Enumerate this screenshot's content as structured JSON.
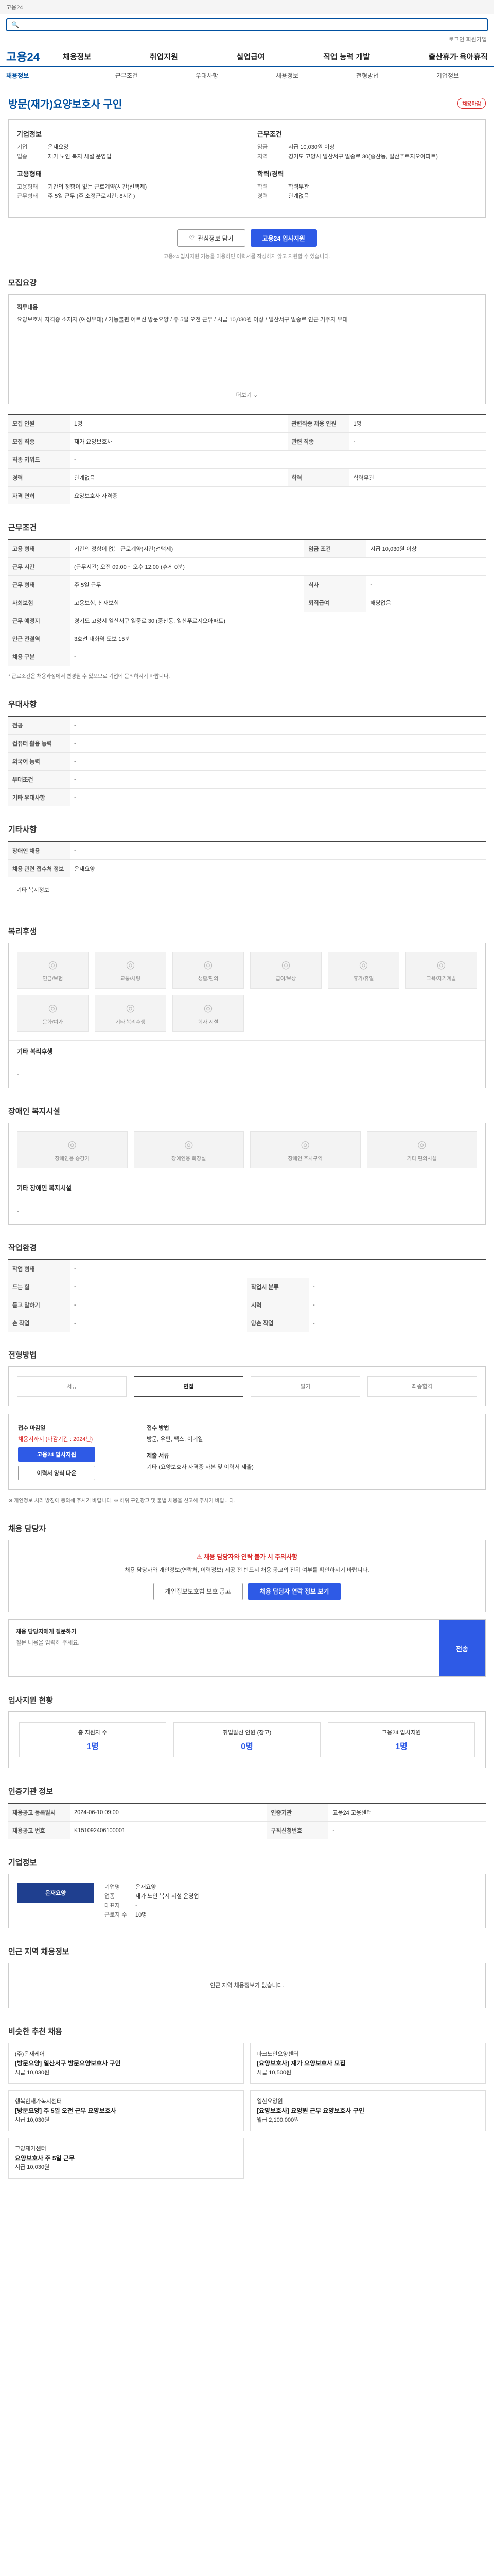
{
  "topbar": {
    "text": "고용24"
  },
  "user_links": "로그인 회원가입",
  "gnb": {
    "logo": "고용24",
    "menu": [
      "채용정보",
      "취업지원",
      "실업급여",
      "직업 능력 개발",
      "출산휴가·육아휴직"
    ]
  },
  "subnav": [
    "채용정보",
    "근무조건",
    "우대사항",
    "채용정보",
    "전형방법",
    "기업정보"
  ],
  "job": {
    "title": "방문(재가)요양보호사 구인",
    "badge": "채용마감",
    "company_label": "기업정보",
    "company": [
      {
        "k": "기업",
        "v": "은재요양"
      },
      {
        "k": "업종",
        "v": "재가 노인 복지 시설 운영업"
      }
    ],
    "cond_label": "근무조건",
    "cond": [
      {
        "k": "임금",
        "v": "시급 10,030원 이상"
      },
      {
        "k": "지역",
        "v": "경기도 고양시 일산서구 일중로 30(중산동, 일산푸르지오아파트)"
      }
    ],
    "type_label": "고용형태",
    "types": [
      {
        "k": "고용형태",
        "v": "기간의 정함이 없는 근로계약(시간(선택제)"
      },
      {
        "k": "근무형태",
        "v": "주 5일 근무 (주 소정근로시간: 8시간)"
      }
    ],
    "exp_label": "학력/경력",
    "exp": [
      {
        "k": "학력",
        "v": "학력무관"
      },
      {
        "k": "경력",
        "v": "관계없음"
      }
    ],
    "btn_scrap": "관심정보 담기",
    "btn_apply": "고용24 입사지원",
    "note": "고용24 입사지원 기능을 이용하면 이력서를 작성하지 않고 지원할 수 있습니다."
  },
  "recruit": {
    "title": "모집요강",
    "desc_head": "직무내용",
    "desc": "요양보호사 자격증 소지자 (여성우대) / 거동불편 어르신 방문요양 / 주 5일 오전 근무 / 시급 10,030원 이상 / 일산서구 일중로 인근 거주자 우대",
    "more": "더보기",
    "rows": [
      {
        "k": "모집 인원",
        "v": "1명",
        "k2": "관련직종 채용 인원",
        "v2": "1명"
      },
      {
        "k": "모집 직종",
        "v": "재가 요양보호사",
        "k2": "관련 직종",
        "v2": "-"
      },
      {
        "k": "직종 키워드",
        "v": "-",
        "k2": "",
        "v2": ""
      },
      {
        "k": "경력",
        "v": "관계없음",
        "k2": "학력",
        "v2": "학력무관"
      },
      {
        "k": "자격 면허",
        "v": "요양보호사 자격증",
        "k2": "",
        "v2": ""
      }
    ]
  },
  "conditions": {
    "title": "근무조건",
    "rows": [
      {
        "k": "고용 형태",
        "v": "기간의 정함이 없는 근로계약(시간(선택제)",
        "k2": "임금 조건",
        "v2": "시급 10,030원 이상"
      },
      {
        "k": "근무 시간",
        "v": "(근무시간) 오전 09:00 ~ 오후 12:00 (휴게 0분)",
        "k2": "",
        "v2": ""
      },
      {
        "k": "근무 형태",
        "v": "주 5일 근무",
        "k2": "식사",
        "v2": "-"
      },
      {
        "k": "사회보험",
        "v": "고용보험, 산재보험",
        "k2": "퇴직급여",
        "v2": "해당없음"
      },
      {
        "k": "근무 예정지",
        "v": "경기도 고양시 일산서구 일중로 30 (중산동, 일산푸르지오아파트)",
        "k2": "",
        "v2": ""
      },
      {
        "k": "인근 전철역",
        "v": "3호선 대화역 도보 15분",
        "k2": "",
        "v2": ""
      },
      {
        "k": "채용 구분",
        "v": "-",
        "k2": "",
        "v2": ""
      }
    ],
    "note": "* 근로조건은 채용과정에서 변경될 수 있으므로 기업에 문의하시기 바랍니다."
  },
  "prefer": {
    "title": "우대사항",
    "rows": [
      {
        "k": "전공",
        "v": "-"
      },
      {
        "k": "컴퓨터 활용 능력",
        "v": "-"
      },
      {
        "k": "외국어 능력",
        "v": "-"
      },
      {
        "k": "우대조건",
        "v": "-"
      },
      {
        "k": "기타 우대사항",
        "v": "-"
      }
    ]
  },
  "etc": {
    "title": "기타사항",
    "rows": [
      {
        "k": "장애인 채용",
        "v": "-"
      },
      {
        "k": "채용 관련 접수처 정보",
        "v": "은재요양"
      }
    ],
    "more": "기타 복지정보"
  },
  "welfare": {
    "title": "복리후생",
    "items": [
      "연금/보험",
      "교통/차량",
      "생활/편의",
      "급여/보상",
      "휴가/휴일",
      "교육/자기계발",
      "문화/여가",
      "기타 복리후생",
      "회사 시설"
    ],
    "subhead": "기타 복리후생",
    "sub_value": "-"
  },
  "disabled": {
    "title": "장애인 복지시설",
    "items": [
      "장애인용 승강기",
      "장애인용 화장실",
      "장애인 주차구역",
      "기타 편의시설"
    ],
    "subhead": "기타 장애인 복지시설",
    "sub_value": "-"
  },
  "workenv": {
    "title": "작업환경",
    "rows": [
      {
        "k": "작업 형태",
        "v": "-",
        "k2": "",
        "v2": ""
      },
      {
        "k": "드는 힘",
        "v": "-",
        "k2": "작업시 분류",
        "v2": "-"
      },
      {
        "k": "듣고 말하기",
        "v": "-",
        "k2": "시력",
        "v2": "-"
      },
      {
        "k": "손 작업",
        "v": "-",
        "k2": "양손 작업",
        "v2": "-"
      }
    ]
  },
  "process": {
    "title": "전형방법",
    "steps": [
      "서류",
      "면접",
      "필기",
      "최종합격"
    ],
    "active": 1
  },
  "apply": {
    "deadline_head": "접수 마감일",
    "deadline": "채용시까지 (마감기간 : 2024년)",
    "btn_apply": "고용24 입사지원",
    "btn_form": "이력서 양식 다운",
    "method_head": "접수 방법",
    "method": "방문, 우편, 팩스, 이메일",
    "docs_head": "제출 서류",
    "docs": "기타 (요양보호사 자격증 사본 및 이력서 제출)",
    "notes": "※ 개인정보 처리 방침에 동의해 주시기 바랍니다. ※ 허위 구인광고 및 불법 채용을 신고해 주시기 바랍니다."
  },
  "warning": {
    "title": "채용 담당자",
    "warn": "채용 담당자와 연락 불가 시 주의사항",
    "body": "채용 담당자와 개인정보(연락처, 이력정보) 제공 전 반드시 채용 공고의 진위 여부를 확인하시기 바랍니다.",
    "btn1": "개인정보보호법 보호 공고",
    "btn2": "채용 담당자 연락 정보 보기",
    "report_head": "채용 담당자에게 질문하기",
    "report_placeholder": "질문 내용을 입력해 주세요.",
    "send": "전송"
  },
  "stats": {
    "title": "입사지원 현황",
    "items": [
      {
        "label": "총 지원자 수",
        "num": "1명"
      },
      {
        "label": "취업알선 인원 (참고)",
        "num": "0명"
      },
      {
        "label": "고용24 입사지원",
        "num": "1명"
      }
    ]
  },
  "meta": {
    "title": "인증기관 정보",
    "rows": [
      {
        "k": "채용공고 등록일시",
        "v": "2024-06-10 09:00",
        "k2": "인증기관",
        "v2": "고용24 고용센터"
      },
      {
        "k": "채용공고 번호",
        "v": "K151092406100001",
        "k2": "구직신청번호",
        "v2": "-"
      }
    ]
  },
  "company_info": {
    "title": "기업정보",
    "logo": "은재요양",
    "rows": [
      {
        "k": "기업명",
        "v": "은재요양"
      },
      {
        "k": "업종",
        "v": "재가 노인 복지 시설 운영업"
      },
      {
        "k": "대표자",
        "v": "-"
      },
      {
        "k": "근로자 수",
        "v": "10명"
      }
    ]
  },
  "similar": {
    "title": "인근 지역 채용정보",
    "empty": "인근 지역 채용정보가 없습니다."
  },
  "recommend": {
    "title": "비슷한 추천 채용",
    "cards": [
      {
        "co": "(주)은재케어",
        "t": "[방문요양] 일산서구 방문요양보호사 구인",
        "w": "시급 10,030원"
      },
      {
        "co": "파크노인요양센터",
        "t": "[요양보호사] 재가 요양보호사 모집",
        "w": "시급 10,500원"
      },
      {
        "co": "행복한재가복지센터",
        "t": "[방문요양] 주 5일 오전 근무 요양보호사",
        "w": "시급 10,030원"
      },
      {
        "co": "일산요양원",
        "t": "[요양보호사] 요양원 근무 요양보호사 구인",
        "w": "월급 2,100,000원"
      },
      {
        "co": "고양재가센터",
        "t": "요양보호사 주 5일 근무",
        "w": "시급 10,030원"
      }
    ]
  }
}
